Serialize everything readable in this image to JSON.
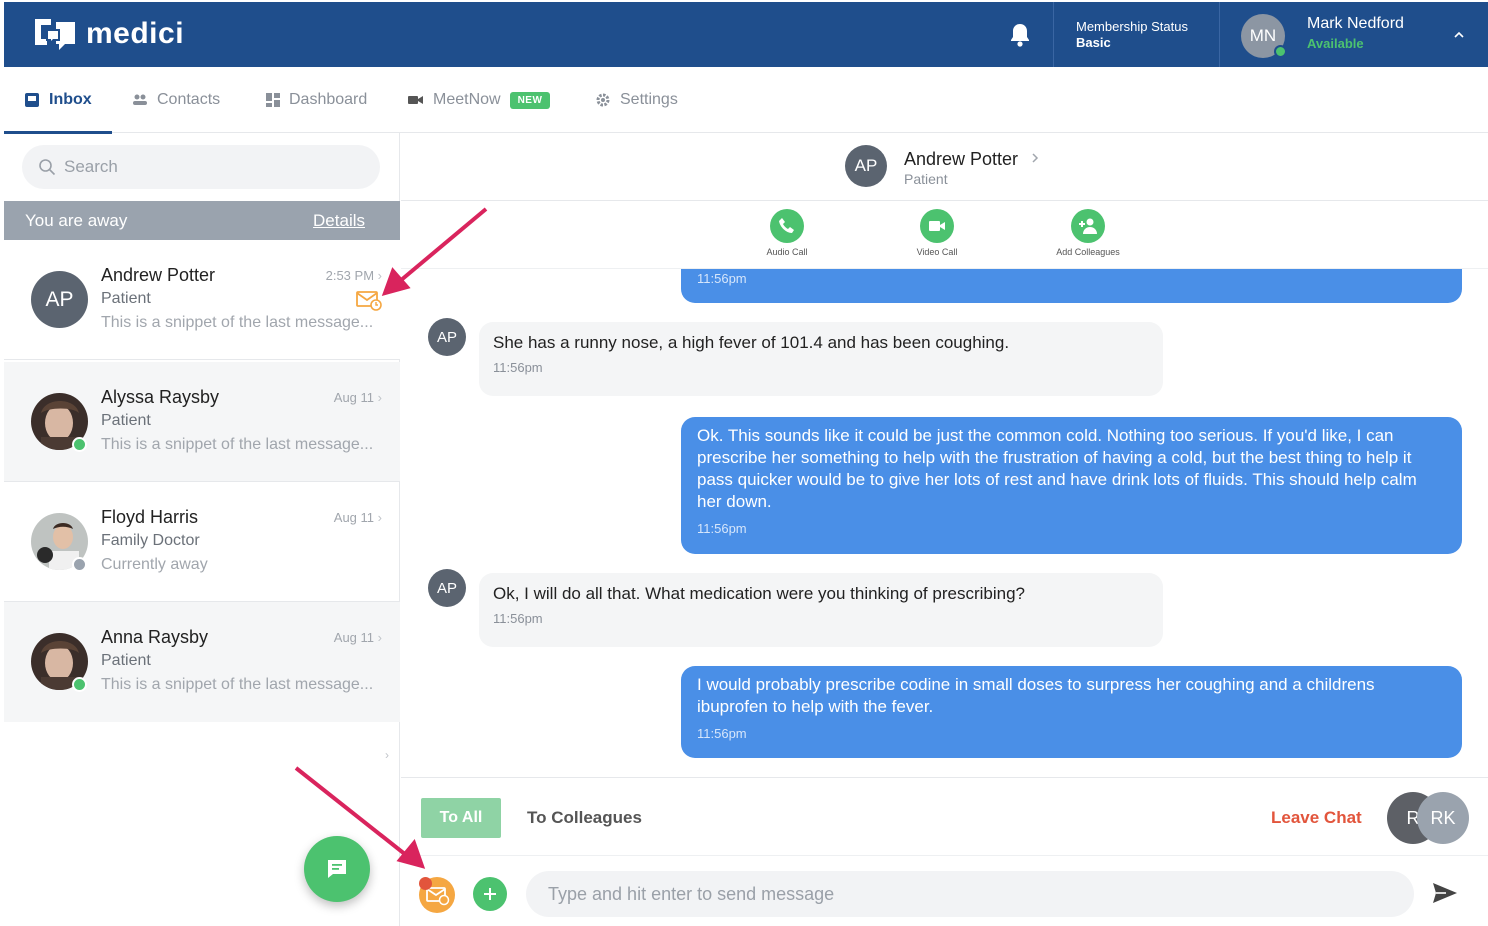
{
  "header": {
    "brand": "medici",
    "membership_label": "Membership Status",
    "membership_value": "Basic",
    "user_initials": "MN",
    "user_name": "Mark Nedford",
    "user_status": "Available"
  },
  "tabs": [
    {
      "label": "Inbox"
    },
    {
      "label": "Contacts"
    },
    {
      "label": "Dashboard"
    },
    {
      "label": "MeetNow",
      "badge": "NEW"
    },
    {
      "label": "Settings"
    }
  ],
  "search": {
    "placeholder": "Search"
  },
  "away_bar": {
    "text": "You are away",
    "link": "Details"
  },
  "conversations": [
    {
      "initials": "AP",
      "name": "Andrew Potter",
      "role": "Patient",
      "snippet": "This is a snippet of the last message...",
      "time": "2:53 PM"
    },
    {
      "name": "Alyssa Raysby",
      "role": "Patient",
      "snippet": "This is a snippet of the last message...",
      "time": "Aug 11",
      "status_color": "#4cc26f"
    },
    {
      "name": "Floyd Harris",
      "role": "Family Doctor",
      "snippet": "Currently away",
      "time": "Aug 11",
      "status_color": "#9aa3ae"
    },
    {
      "name": "Anna Raysby",
      "role": "Patient",
      "snippet": "This is a snippet of the last message...",
      "time": "Aug 11",
      "status_color": "#4cc26f"
    }
  ],
  "chat": {
    "initials": "AP",
    "name": "Andrew Potter",
    "role": "Patient",
    "actions": [
      {
        "label": "Audio Call"
      },
      {
        "label": "Video Call"
      },
      {
        "label": "Add Colleagues"
      }
    ],
    "messages": [
      {
        "dir": "out",
        "text": "",
        "time": "11:56pm"
      },
      {
        "dir": "in",
        "initials": "AP",
        "text": "She has a runny nose, a high fever of 101.4 and has been coughing.",
        "time": "11:56pm"
      },
      {
        "dir": "out",
        "text": "Ok. This sounds like it could be just the common cold. Nothing too serious. If you'd like, I can prescribe her something to help with the frustration of having a cold, but the best thing to help it pass quicker would be to give her lots of rest and have drink lots of fluids. This should help calm her down.",
        "time": "11:56pm"
      },
      {
        "dir": "in",
        "initials": "AP",
        "text": "Ok, I will do all that. What medication were you thinking of prescribing?",
        "time": "11:56pm"
      },
      {
        "dir": "out",
        "text": "I would probably prescribe codine in small doses to surpress her coughing and a childrens ibuprofen to help with the fever.",
        "time": "11:56pm"
      }
    ],
    "reply_modes": {
      "to_all": "To All",
      "to_colleagues": "To Colleagues"
    },
    "leave": "Leave Chat",
    "participants": [
      "R",
      "RK"
    ],
    "composer_placeholder": "Type and hit enter to send message"
  },
  "colors": {
    "brand": "#1f4e8c",
    "accent_green": "#4cc26f",
    "bubble_blue": "#4a8fe7",
    "leave_red": "#e2553c",
    "annotation_arrow": "#d9245d"
  }
}
